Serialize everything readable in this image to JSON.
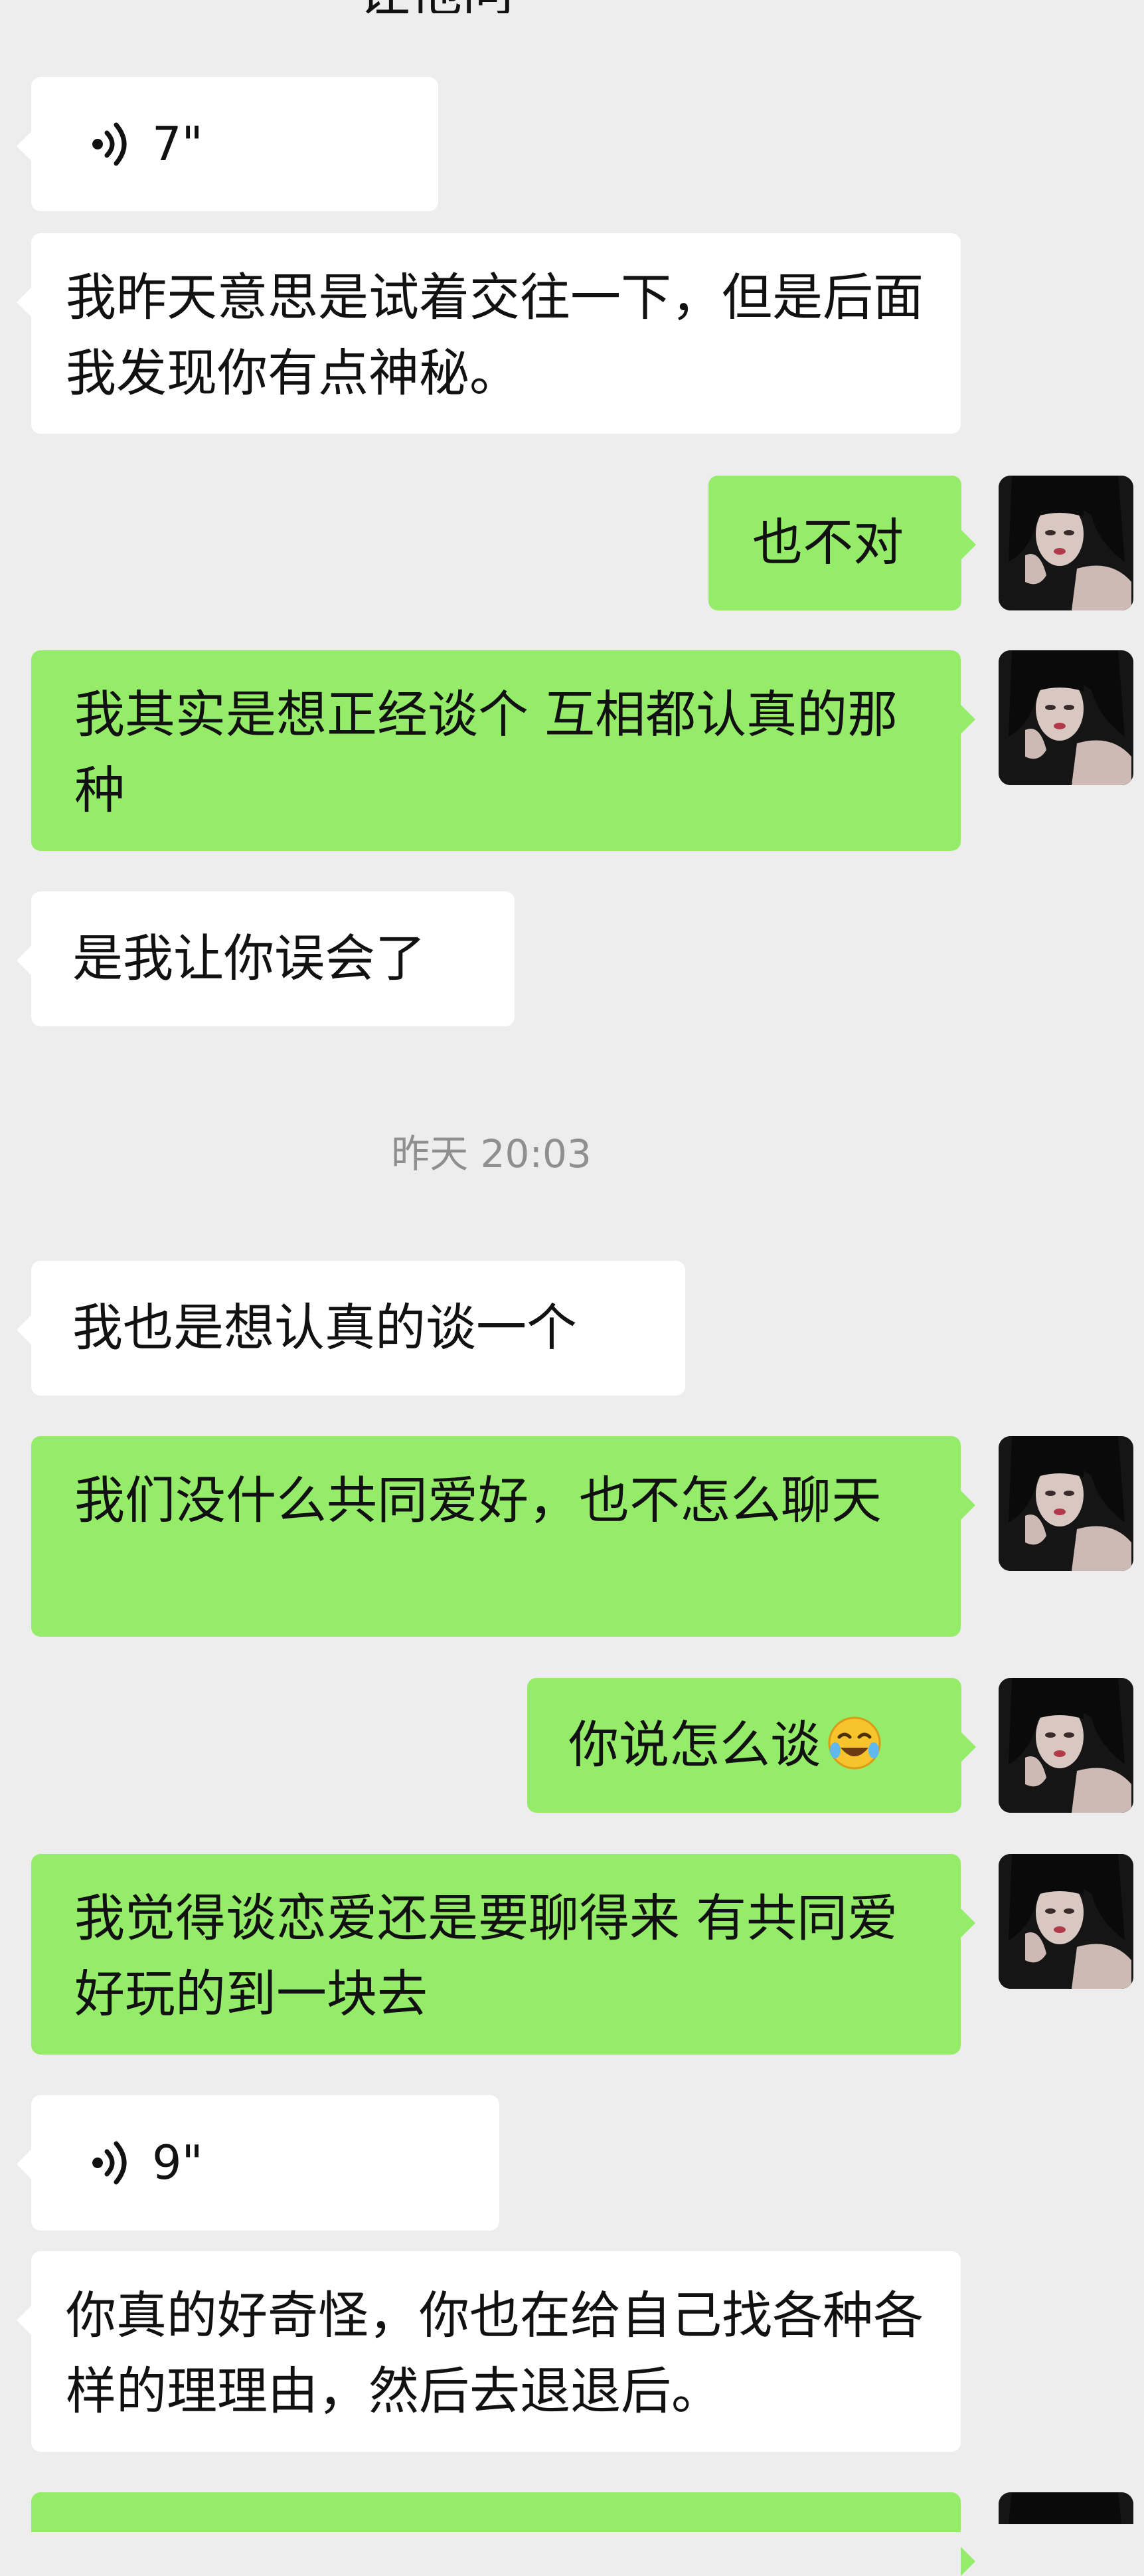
{
  "top_fragment": "让他问",
  "messages": [
    {
      "type": "voice",
      "duration": "7\""
    },
    {
      "type": "text",
      "text": "我昨天意思是试着交往一下，但是后面我发现你有点神秘。"
    },
    {
      "type": "text",
      "text": "也不对"
    },
    {
      "type": "text",
      "text": "我其实是想正经谈个  互相都认真的那种"
    },
    {
      "type": "text",
      "text": "是我让你误会了"
    },
    {
      "type": "text",
      "text": "我也是想认真的谈一个"
    },
    {
      "type": "text",
      "text": "我们没什么共同爱好，也不怎么聊天"
    },
    {
      "type": "text",
      "text": "你说怎么谈",
      "emoji": "laughing-crying-emoji"
    },
    {
      "type": "text",
      "text": "我觉得谈恋爱还是要聊得来 有共同爱好玩的到一块去"
    },
    {
      "type": "voice",
      "duration": "9\""
    },
    {
      "type": "text",
      "text": "你真的好奇怪，你也在给自己找各种各样的理理由，然后去退退后。"
    }
  ],
  "timestamp": "昨天 20:03",
  "icons": {
    "voice": "voice-icon",
    "avatar": "avatar-image"
  },
  "colors": {
    "background": "#ededed",
    "incoming_bubble": "#ffffff",
    "outgoing_bubble": "#95ec69",
    "timestamp_text": "#8f8f8f"
  }
}
